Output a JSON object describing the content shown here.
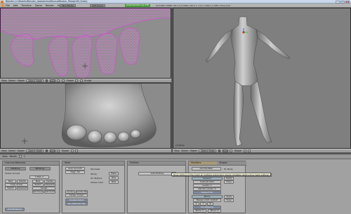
{
  "window": {
    "title": "Blender [c:\\Models\\Blender_data\\AnimalRescueMission_Pb\\sigh3D_finals]",
    "controls": [
      "_",
      "□",
      "X"
    ]
  },
  "menubar": {
    "items": [
      "File",
      "Add",
      "Timeline",
      "Game",
      "Render",
      "Help"
    ],
    "screen": "SR:2-Model",
    "scene": "SCE:Scene",
    "web_plugin": "www.blender.org 248",
    "stats": "Ve:1490-17896 | Fa:1 6-17096 | Ob:1-1 | La:1 | Mem:1.70M | Time:(1)4"
  },
  "viewports": {
    "top_left": {
      "header": [
        "View",
        "Select",
        "Object",
        "Object Mode",
        "Local",
        "Global",
        "Sculpt"
      ],
      "mode": "Object Mode"
    },
    "bottom_left": {
      "header": [
        "View",
        "Select",
        "Object",
        "Object Mode",
        "Global"
      ],
      "mode": "Object Mode"
    },
    "right": {
      "header": [
        "View",
        "Select",
        "Object",
        "Object Mode",
        "Global"
      ],
      "mode": "Object Mode",
      "corner_label": "(1) Body"
    }
  },
  "buttons_window": {
    "header": [
      "View",
      "Panels"
    ],
    "frame": "1",
    "panels": {
      "link": {
        "title": "Link and Materials",
        "object_name": "OB:Body",
        "mesh_name": "ME:Body",
        "vertex_groups": "Vertex Groups",
        "material_counter": "0 Mat: 0",
        "row1": [
          "New",
          "Delete",
          "New",
          "Delete"
        ],
        "row2": [
          "Copy Group",
          "Select",
          "Deselect"
        ],
        "row3": [
          "Select",
          "Deselect"
        ],
        "row4": [
          "Assign"
        ],
        "set_smooth": "Set Smooth",
        "set_solid": "Set Solid",
        "autotexspace": "AutoTexSpace"
      },
      "mesh": {
        "title": "Mesh",
        "auto_smooth": "Auto Smooth",
        "degr": "Degr: 30",
        "sticky": "Sticky",
        "uv_texture": "UV Texture",
        "vertex_color": "Vertex Color",
        "make": "Make",
        "new": "New",
        "center": "Center",
        "center_new": "Center New",
        "center_cursor": "Center Cursor",
        "double_sided": "Double Sided",
        "no_v_normal_flip": "No V.Normal Flip"
      },
      "multires": {
        "title": "Multires",
        "add_multires": "Add Multires"
      },
      "modifiers": {
        "tab_modifiers": "Modifiers",
        "tab_shapes": "Shapes",
        "add_modifier": "Add Modifier",
        "to": "To: Body",
        "modifier_name": "Subsurf",
        "catmull_clark": "Catmull-Clark",
        "levels": "Levels: 1",
        "render_levels": "Render Levels: 2",
        "apply": "Apply",
        "copy": "Copy",
        "subsurf_uv": "Subsurf UV",
        "mirror_name": "Mirror",
        "merge_limit": "Merge Limit: 0.0010",
        "do_clipping": "Do Clipping",
        "mirror_x": "X",
        "mirror_y": "Y",
        "mirror_z": "Z",
        "mirror_u": "Mirror U",
        "mirror_v": "Mirror V"
      }
    },
    "tooltip": "Allow editing of the mesh at multiple subdivision levels (disables destructive mesh editing)"
  }
}
